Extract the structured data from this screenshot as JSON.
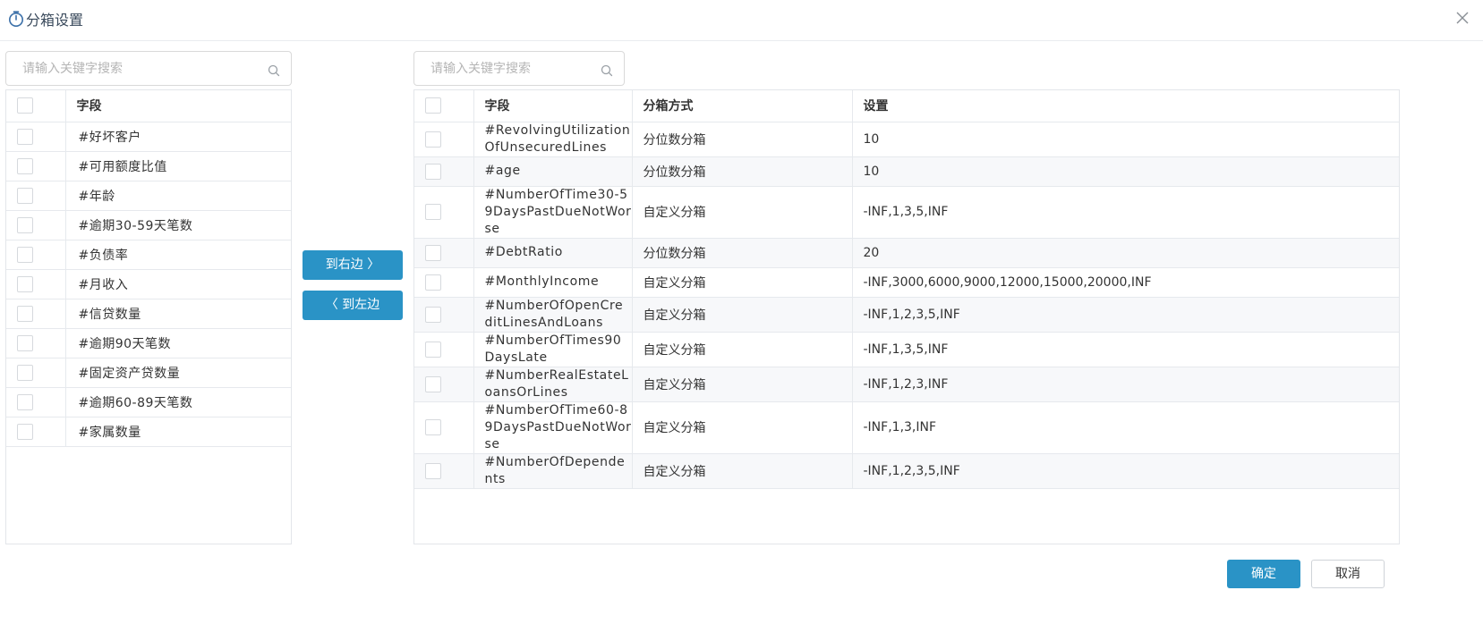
{
  "dialog": {
    "title": "分箱设置"
  },
  "left": {
    "search_placeholder": "请输入关键字搜索",
    "header": "字段",
    "items": [
      "#好坏客户",
      "#可用额度比值",
      "#年龄",
      "#逾期30-59天笔数",
      "#负债率",
      "#月收入",
      "#信贷数量",
      "#逾期90天笔数",
      "#固定资产贷数量",
      "#逾期60-89天笔数",
      "#家属数量"
    ]
  },
  "transfer": {
    "to_right": "到右边 〉",
    "to_left": "〈 到左边"
  },
  "right": {
    "search_placeholder": "请输入关键字搜索",
    "headers": {
      "field": "字段",
      "method": "分箱方式",
      "setting": "设置"
    },
    "rows": [
      {
        "field": "#RevolvingUtilizationOfUnsecuredLines",
        "method": "分位数分箱",
        "setting": "10"
      },
      {
        "field": "#age",
        "method": "分位数分箱",
        "setting": "10"
      },
      {
        "field": "#NumberOfTime30-59DaysPastDueNotWorse",
        "method": "自定义分箱",
        "setting": "-INF,1,3,5,INF"
      },
      {
        "field": "#DebtRatio",
        "method": "分位数分箱",
        "setting": "20"
      },
      {
        "field": "#MonthlyIncome",
        "method": "自定义分箱",
        "setting": "-INF,3000,6000,9000,12000,15000,20000,INF"
      },
      {
        "field": "#NumberOfOpenCreditLinesAndLoans",
        "method": "自定义分箱",
        "setting": "-INF,1,2,3,5,INF"
      },
      {
        "field": "#NumberOfTimes90DaysLate",
        "method": "自定义分箱",
        "setting": "-INF,1,3,5,INF"
      },
      {
        "field": "#NumberRealEstateLoansOrLines",
        "method": "自定义分箱",
        "setting": "-INF,1,2,3,INF"
      },
      {
        "field": "#NumberOfTime60-89DaysPastDueNotWorse",
        "method": "自定义分箱",
        "setting": "-INF,1,3,INF"
      },
      {
        "field": "#NumberOfDependents",
        "method": "自定义分箱",
        "setting": "-INF,1,2,3,5,INF"
      }
    ]
  },
  "footer": {
    "ok": "确定",
    "cancel": "取消"
  },
  "colors": {
    "primary": "#2a93c6",
    "border": "#e3e6ea",
    "stripe": "#f7f8fa"
  },
  "icons": {
    "title": "timer-icon",
    "close": "close-icon",
    "search": "search-icon"
  }
}
